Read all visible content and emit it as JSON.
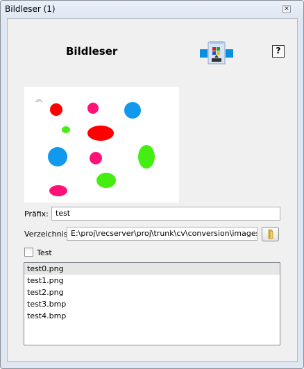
{
  "window": {
    "title": "Bildleser (1)"
  },
  "header": {
    "title": "Bildleser",
    "help_label": "?"
  },
  "preview": {
    "caption": ".:/!!:.",
    "shapes": [
      {
        "kind": "ellipse",
        "color": "#ff0000"
      },
      {
        "kind": "ellipse",
        "color": "#ff1177"
      },
      {
        "kind": "ellipse",
        "color": "#1199ee"
      },
      {
        "kind": "ellipse",
        "color": "#44ee11"
      },
      {
        "kind": "ellipse",
        "color": "#ff0000"
      },
      {
        "kind": "ellipse",
        "color": "#1199ee"
      },
      {
        "kind": "ellipse",
        "color": "#ff1177"
      },
      {
        "kind": "ellipse",
        "color": "#44ee11"
      },
      {
        "kind": "ellipse",
        "color": "#44ee11"
      },
      {
        "kind": "ellipse",
        "color": "#ff1177"
      }
    ]
  },
  "form": {
    "prefix_label": "Präfix:",
    "prefix_value": "test",
    "directory_label": "Verzeichnis:",
    "directory_value": "E:\\proj\\recserver\\proj\\trunk\\cv\\conversion\\images",
    "test_label": "Test",
    "test_checked": false
  },
  "files": [
    "test0.png",
    "test1.png",
    "test2.png",
    "test3.bmp",
    "test4.bmp"
  ],
  "selected_index": 0
}
